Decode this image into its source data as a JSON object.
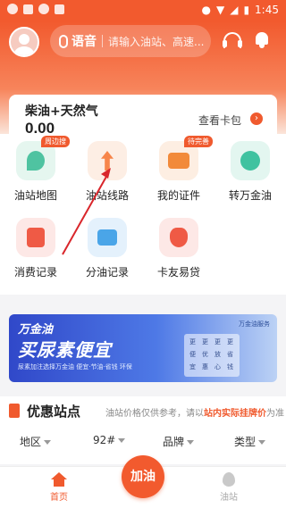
{
  "status_bar": {
    "time": "1:45"
  },
  "header": {
    "voice_label": "语音",
    "search_placeholder": "请输入油站、高速..."
  },
  "card": {
    "title": "柴油+天然气",
    "value": "0.00",
    "link_label": "查看卡包"
  },
  "menu": [
    {
      "label": "油站地图",
      "icon": "map-icon",
      "tag": "周边搜",
      "color": "#4fc3a1"
    },
    {
      "label": "油站线路",
      "icon": "route-icon",
      "tag": "",
      "color": "#f7854a"
    },
    {
      "label": "我的证件",
      "icon": "id-card-icon",
      "tag": "待完善",
      "color": "#f28a3a"
    },
    {
      "label": "转万金油",
      "icon": "transfer-icon",
      "tag": "",
      "color": "#3fc2a0"
    },
    {
      "label": "消费记录",
      "icon": "receipt-icon",
      "tag": "",
      "color": "#ef5a45"
    },
    {
      "label": "分油记录",
      "icon": "wallet-icon",
      "tag": "",
      "color": "#4aa5e8"
    },
    {
      "label": "卡友易贷",
      "icon": "money-bag-icon",
      "tag": "",
      "color": "#ef5a45"
    }
  ],
  "banner": {
    "line1": "万金油",
    "line2": "买尿素便宜",
    "line3": "尿素加注选择万金油  便宜·节油·省钱 环保",
    "brand": "万金油服务",
    "box_chars": [
      "更",
      "更",
      "更",
      "更",
      "便",
      "优",
      "放",
      "省",
      "宜",
      "惠",
      "心",
      "钱"
    ]
  },
  "section": {
    "title": "优惠站点",
    "note_prefix": "油站价格仅供参考，请以",
    "note_highlight": "站内实际挂牌价",
    "note_suffix": "为准",
    "filters": [
      "地区",
      "92#",
      "品牌",
      "类型"
    ]
  },
  "tabbar": {
    "home_label": "首页",
    "fuel_label": "加油",
    "station_label": "油站"
  },
  "colors": {
    "brand_orange": "#f25a2e",
    "annotation_red": "#d9262b"
  }
}
